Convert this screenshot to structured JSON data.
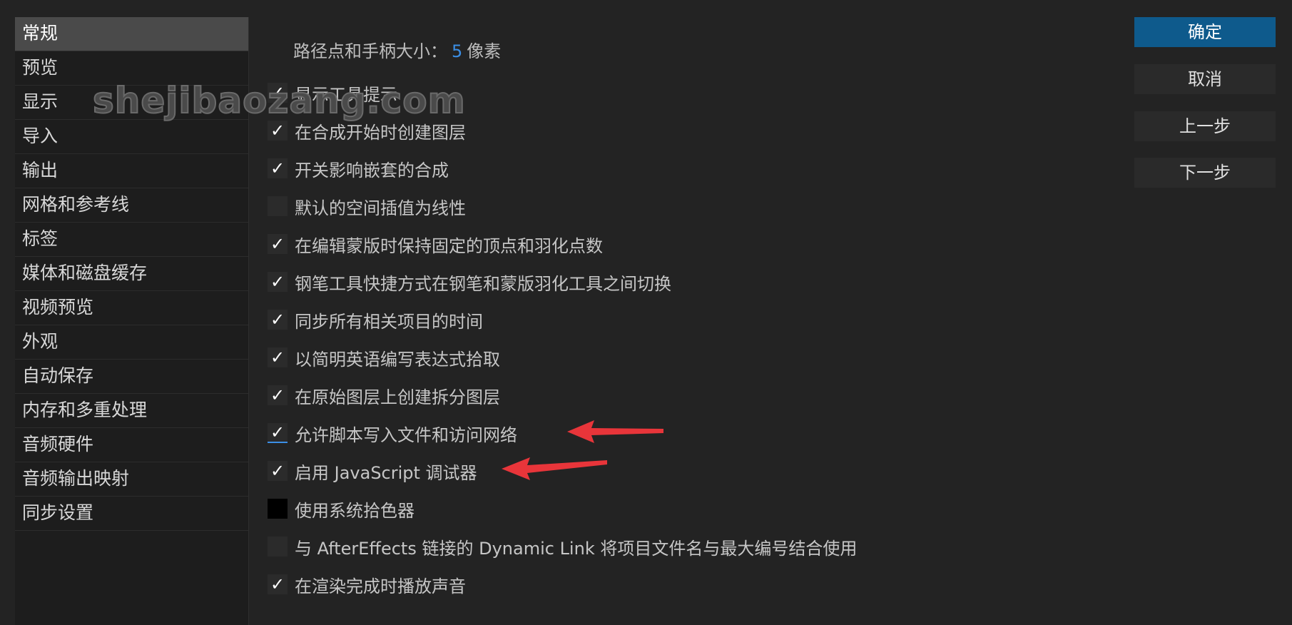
{
  "sidebar": {
    "items": [
      {
        "label": "常规",
        "selected": true
      },
      {
        "label": "预览"
      },
      {
        "label": "显示"
      },
      {
        "label": "导入"
      },
      {
        "label": "输出"
      },
      {
        "label": "网格和参考线"
      },
      {
        "label": "标签"
      },
      {
        "label": "媒体和磁盘缓存"
      },
      {
        "label": "视频预览"
      },
      {
        "label": "外观"
      },
      {
        "label": "自动保存"
      },
      {
        "label": "内存和多重处理"
      },
      {
        "label": "音频硬件"
      },
      {
        "label": "音频输出映射"
      },
      {
        "label": "同步设置"
      }
    ]
  },
  "main": {
    "path_size": {
      "label": "路径点和手柄大小：",
      "value": "5",
      "unit": "像素"
    },
    "options": [
      {
        "label": "显示工具提示",
        "checked": true
      },
      {
        "label": "在合成开始时创建图层",
        "checked": true
      },
      {
        "label": "开关影响嵌套的合成",
        "checked": true
      },
      {
        "label": "默认的空间插值为线性",
        "checked": false
      },
      {
        "label": "在编辑蒙版时保持固定的顶点和羽化点数",
        "checked": true
      },
      {
        "label": "钢笔工具快捷方式在钢笔和蒙版羽化工具之间切换",
        "checked": true
      },
      {
        "label": "同步所有相关项目的时间",
        "checked": true
      },
      {
        "label": "以简明英语编写表达式拾取",
        "checked": true
      },
      {
        "label": "在原始图层上创建拆分图层",
        "checked": true
      },
      {
        "label": "允许脚本写入文件和访问网络",
        "checked": true
      },
      {
        "label": "启用 JavaScript 调试器",
        "checked": true
      },
      {
        "label": "使用系统拾色器",
        "checked": false
      },
      {
        "label": "与 AfterEffects 链接的 Dynamic Link 将项目文件名与最大编号结合使用",
        "checked": false
      },
      {
        "label": "在渲染完成时播放声音",
        "checked": true
      }
    ]
  },
  "buttons": {
    "ok": "确定",
    "cancel": "取消",
    "prev": "上一步",
    "next": "下一步"
  },
  "watermark": "shejibaozang.com",
  "check_glyph": "✓",
  "colors": {
    "accent_blue": "#0e5a8c",
    "value_blue": "#3b8fe6",
    "arrow_red": "#e8353a",
    "background": "#232323"
  },
  "icons": [
    "checkbox-checked-icon",
    "checkbox-unchecked-icon",
    "red-arrow-annotation"
  ]
}
